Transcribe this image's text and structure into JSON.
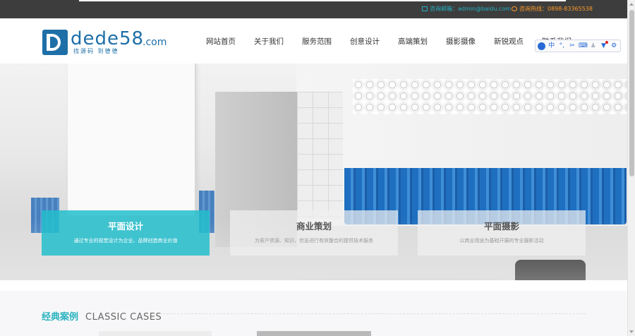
{
  "topbar": {
    "email_text": "咨询邮箱：admin@baidu.com",
    "phone_text": "咨询热线：0898-83365538",
    "colors": {
      "email": "#23b2c4",
      "phone": "#ff9a28",
      "background": "#3d3d3d"
    }
  },
  "logo": {
    "name": "dede",
    "number": "58",
    "domain": ".com",
    "slogan": "找源码  到德德"
  },
  "nav": {
    "items": [
      "网站首页",
      "关于我们",
      "服务范围",
      "创意设计",
      "高端策划",
      "摄影摄像",
      "新锐观点",
      "联系我们"
    ]
  },
  "toolbar": {
    "icons": [
      "user-circle-icon",
      "language-zh-icon",
      "punctuation-icon",
      "scissors-icon",
      "keyboard-icon",
      "person-icon",
      "shirt-icon",
      "gear-icon"
    ],
    "language_label": "中"
  },
  "hero": {
    "cards": [
      {
        "title": "平面设计",
        "desc": "通过专业的视觉设计为企业、品牌创造商业价值",
        "active": true
      },
      {
        "title": "商业策划",
        "desc": "为客户资源、知识、信息进行有效整合的提供技术服务",
        "active": false
      },
      {
        "title": "平面摄影",
        "desc": "以商业用途为基础开展的专业摄影活动",
        "active": false
      }
    ]
  },
  "cases": {
    "title_zh": "经典案例",
    "title_en": "CLASSIC CASES"
  },
  "colors": {
    "accent": "#2bb3c0",
    "brand_blue": "#1e6fa8"
  }
}
